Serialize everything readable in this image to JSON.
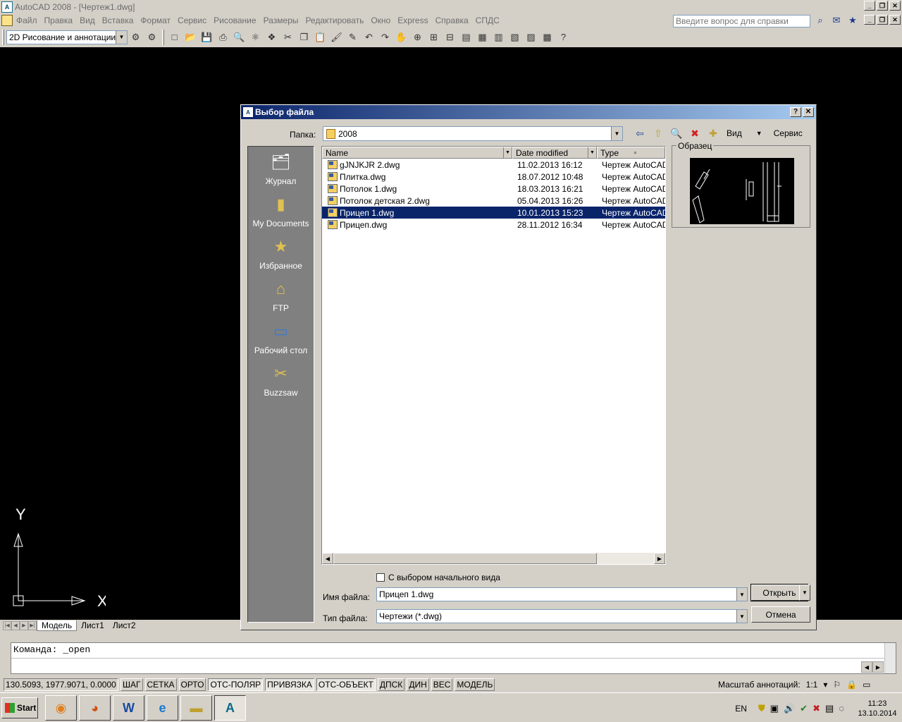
{
  "window": {
    "title": "AutoCAD 2008 - [Чертеж1.dwg]",
    "app_icon": "autocad-icon"
  },
  "menu": {
    "items": [
      "Файл",
      "Правка",
      "Вид",
      "Вставка",
      "Формат",
      "Сервис",
      "Рисование",
      "Размеры",
      "Редактировать",
      "Окно",
      "Express",
      "Справка",
      "СПДС"
    ],
    "help_placeholder": "Введите вопрос для справки"
  },
  "toolbar": {
    "workspace": "2D Рисование и аннотации"
  },
  "ucs": {
    "y": "Y",
    "x": "X"
  },
  "layout_tabs": [
    "Модель",
    "Лист1",
    "Лист2"
  ],
  "command": {
    "line1": "Команда: _open",
    "line2": ""
  },
  "status": {
    "coords": "130.5093, 1977.9071, 0.0000",
    "buttons": [
      "ШАГ",
      "СЕТКА",
      "ОРТО",
      "ОТС-ПОЛЯР",
      "ПРИВЯЗКА",
      "ОТС-ОБЪЕКТ",
      "ДПСК",
      "ДИН",
      "ВЕС",
      "МОДЕЛЬ"
    ],
    "anno_label": "Масштаб аннотаций:",
    "anno_value": "1:1"
  },
  "taskbar": {
    "start": "Start",
    "lang": "EN",
    "time": "11:23",
    "date": "13.10.2014"
  },
  "dialog": {
    "title": "Выбор файла",
    "folder_label": "Папка:",
    "folder": "2008",
    "view_label": "Вид",
    "tools_label": "Сервис",
    "places": [
      "Журнал",
      "My Documents",
      "Избранное",
      "FTP",
      "Рабочий стол",
      "Buzzsaw"
    ],
    "columns": {
      "name": "Name",
      "date": "Date modified",
      "type": "Type"
    },
    "files": [
      {
        "name": "gJNJKJR 2.dwg",
        "date": "11.02.2013 16:12",
        "type": "Чертеж AutoCAD"
      },
      {
        "name": "Плитка.dwg",
        "date": "18.07.2012 10:48",
        "type": "Чертеж AutoCAD"
      },
      {
        "name": "Потолок 1.dwg",
        "date": "18.03.2013 16:21",
        "type": "Чертеж AutoCAD"
      },
      {
        "name": "Потолок детская 2.dwg",
        "date": "05.04.2013 16:26",
        "type": "Чертеж AutoCAD"
      },
      {
        "name": "Прицеп 1.dwg",
        "date": "10.01.2013 15:23",
        "type": "Чертеж AutoCAD",
        "selected": true
      },
      {
        "name": "Прицеп.dwg",
        "date": "28.11.2012 16:34",
        "type": "Чертеж AutoCAD"
      }
    ],
    "preview_label": "Образец",
    "initial_view_label": "С выбором начального вида",
    "filename_label": "Имя файла:",
    "filename": "Прицеп 1.dwg",
    "filetype_label": "Тип файла:",
    "filetype": "Чертежи (*.dwg)",
    "open_label": "Открыть",
    "cancel_label": "Отмена"
  }
}
